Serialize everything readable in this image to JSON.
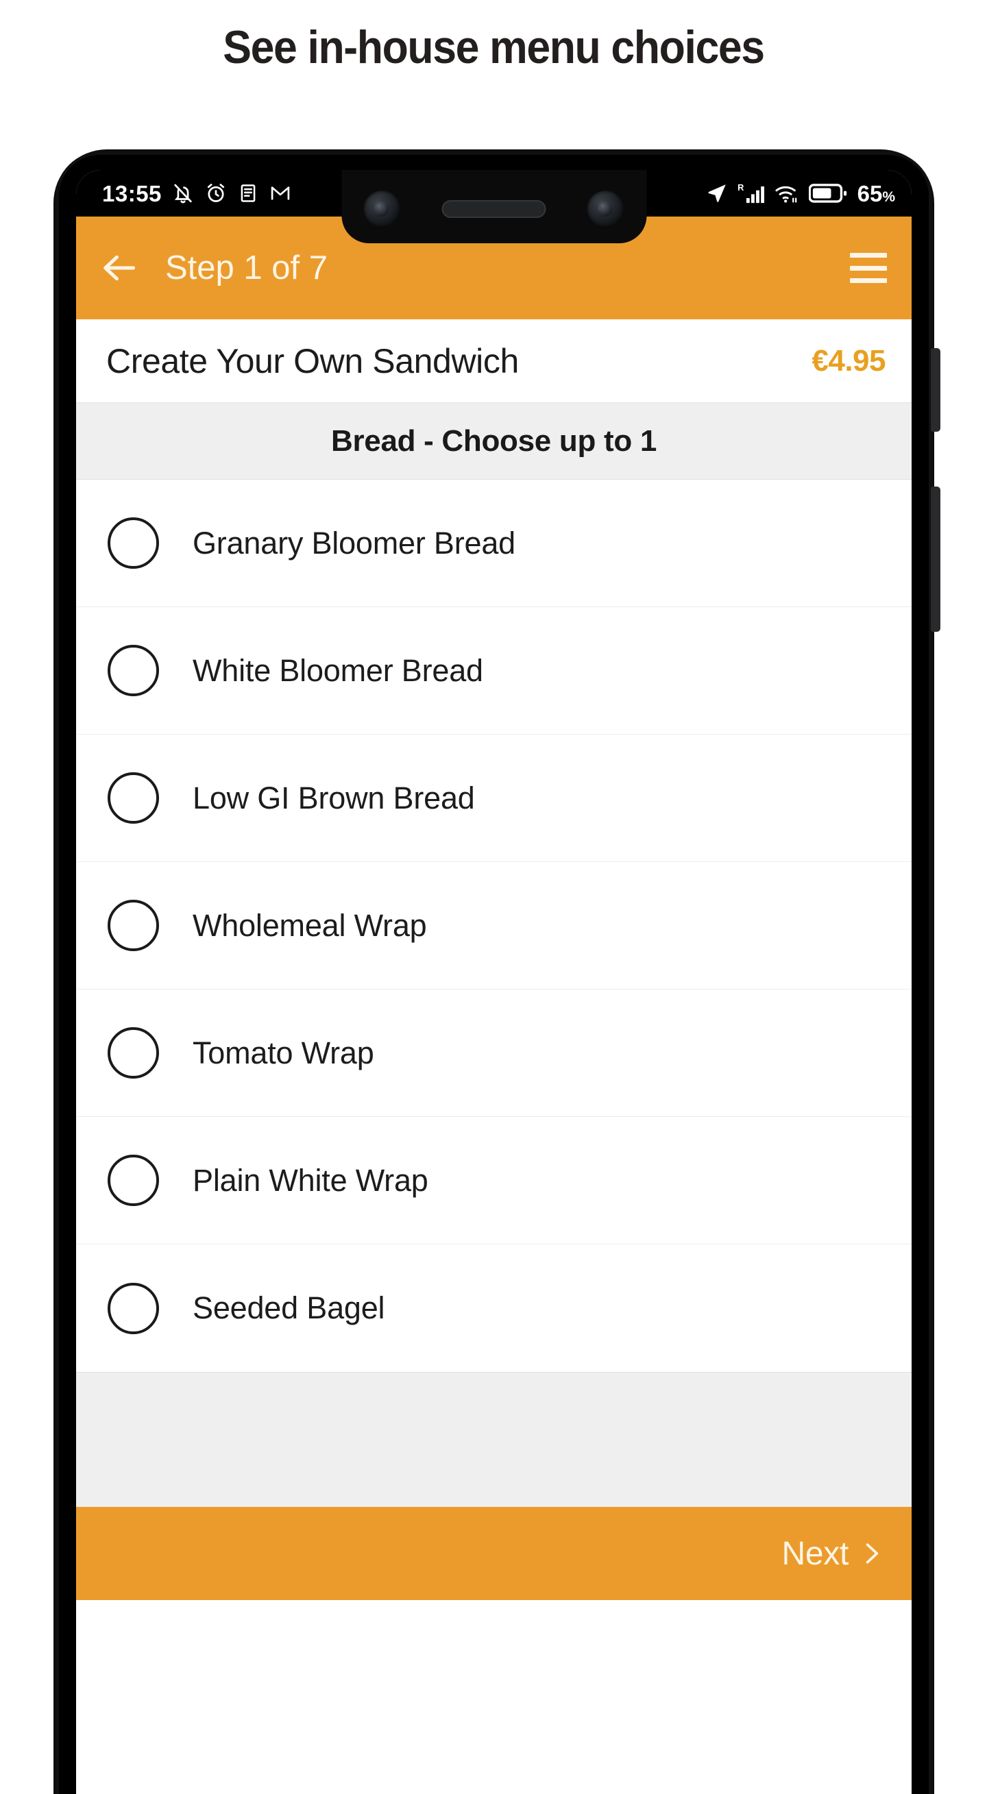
{
  "headline": "See in-house menu choices",
  "colors": {
    "brand_orange": "#EB9B2C",
    "price_orange": "#E8A020",
    "section_bg": "#efefef",
    "text_dark": "#1c1c1c",
    "appbar_text": "#fdf5e6"
  },
  "status_bar": {
    "time": "13:55",
    "left_icons": [
      "notifications-muted-icon",
      "alarm-clock-icon",
      "notes-icon",
      "gmail-icon"
    ],
    "right_icons": [
      "location-arrow-icon",
      "roaming-signal-icon",
      "wifi-icon",
      "battery-icon"
    ],
    "roaming_label": "R",
    "battery_percent": "65",
    "battery_percent_symbol": "%"
  },
  "app_bar": {
    "back_icon": "arrow-left-icon",
    "title": "Step 1 of 7",
    "menu_icon": "hamburger-menu-icon"
  },
  "product": {
    "name": "Create Your Own Sandwich",
    "price": "€4.95"
  },
  "section": {
    "header": "Bread - Choose up to 1"
  },
  "options": [
    {
      "label": "Granary Bloomer Bread",
      "selected": false
    },
    {
      "label": "White Bloomer Bread",
      "selected": false
    },
    {
      "label": "Low GI Brown Bread",
      "selected": false
    },
    {
      "label": "Wholemeal Wrap",
      "selected": false
    },
    {
      "label": "Tomato Wrap",
      "selected": false
    },
    {
      "label": "Plain White Wrap",
      "selected": false
    },
    {
      "label": "Seeded Bagel",
      "selected": false
    }
  ],
  "footer": {
    "next_label": "Next",
    "next_icon": "chevron-right-icon"
  }
}
